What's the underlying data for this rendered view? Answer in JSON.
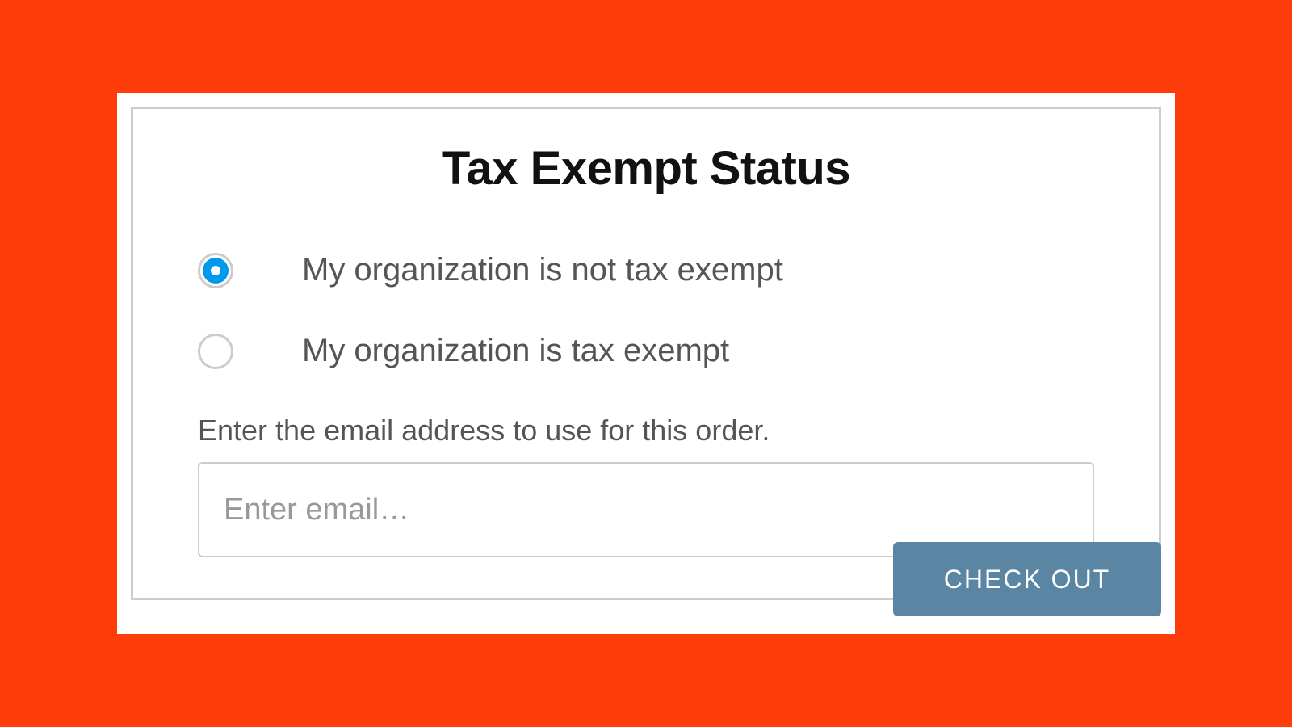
{
  "form": {
    "title": "Tax Exempt Status",
    "radio_options": [
      {
        "label": "My organization is not tax exempt",
        "selected": true
      },
      {
        "label": "My organization is tax exempt",
        "selected": false
      }
    ],
    "email_prompt": "Enter the email address to use for this order.",
    "email_placeholder": "Enter email…",
    "email_value": ""
  },
  "actions": {
    "checkout_label": "CHECK OUT"
  },
  "colors": {
    "background": "#ff3d0a",
    "radio_selected": "#0099ee",
    "button": "#5b86a3"
  }
}
